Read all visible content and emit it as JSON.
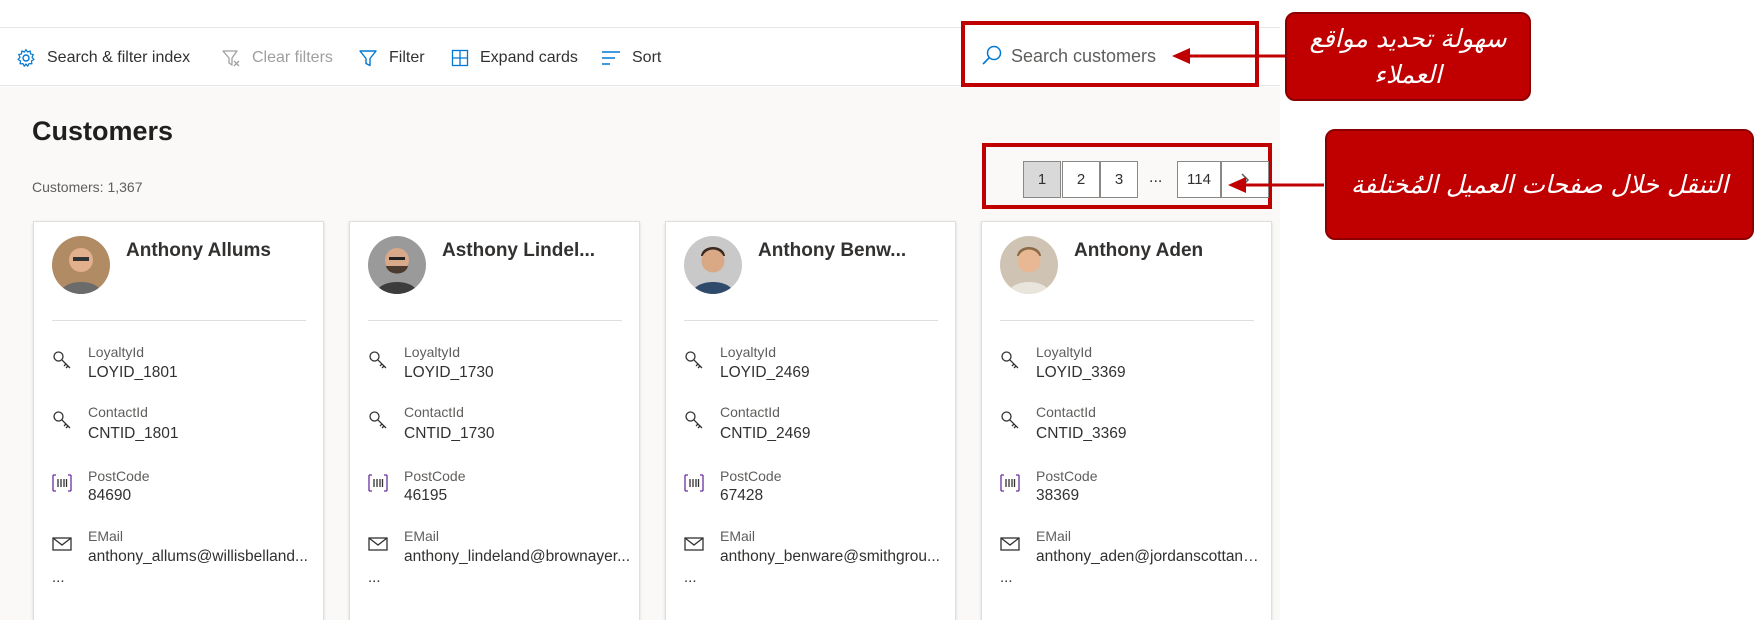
{
  "toolbar": {
    "search_filter_index": "Search & filter index",
    "clear_filters": "Clear filters",
    "filter": "Filter",
    "expand_cards": "Expand cards",
    "sort": "Sort"
  },
  "search": {
    "placeholder": "Search customers"
  },
  "page": {
    "title": "Customers",
    "count_text": "Customers: 1,367"
  },
  "pagination": {
    "pages": [
      "1",
      "2",
      "3"
    ],
    "ellipsis": "...",
    "last": "114",
    "current": "1"
  },
  "field_labels": {
    "loyalty": "LoyaltyId",
    "contact": "ContactId",
    "postcode": "PostCode",
    "email": "EMail"
  },
  "cards": [
    {
      "name": "Anthony Allums",
      "loyalty": "LOYID_1801",
      "contact": "CNTID_1801",
      "postcode": "84690",
      "email": "anthony_allums@willisbelland...",
      "more": "..."
    },
    {
      "name": "Asthony Lindel...",
      "loyalty": "LOYID_1730",
      "contact": "CNTID_1730",
      "postcode": "46195",
      "email": "anthony_lindeland@brownayer...",
      "more": "..."
    },
    {
      "name": "Anthony Benw...",
      "loyalty": "LOYID_2469",
      "contact": "CNTID_2469",
      "postcode": "67428",
      "email": "anthony_benware@smithgrou...",
      "more": "..."
    },
    {
      "name": "Anthony Aden",
      "loyalty": "LOYID_3369",
      "contact": "CNTID_3369",
      "postcode": "38369",
      "email": "anthony_aden@jordanscottand...",
      "more": "..."
    }
  ],
  "callouts": {
    "search": "سهولة تحديد مواقع العملاء",
    "pages": "التنقل خلال صفحات العميل المُختلفة"
  },
  "colors": {
    "accent": "#0078d4",
    "callout": "#c00000",
    "background": "#faf9f8"
  }
}
